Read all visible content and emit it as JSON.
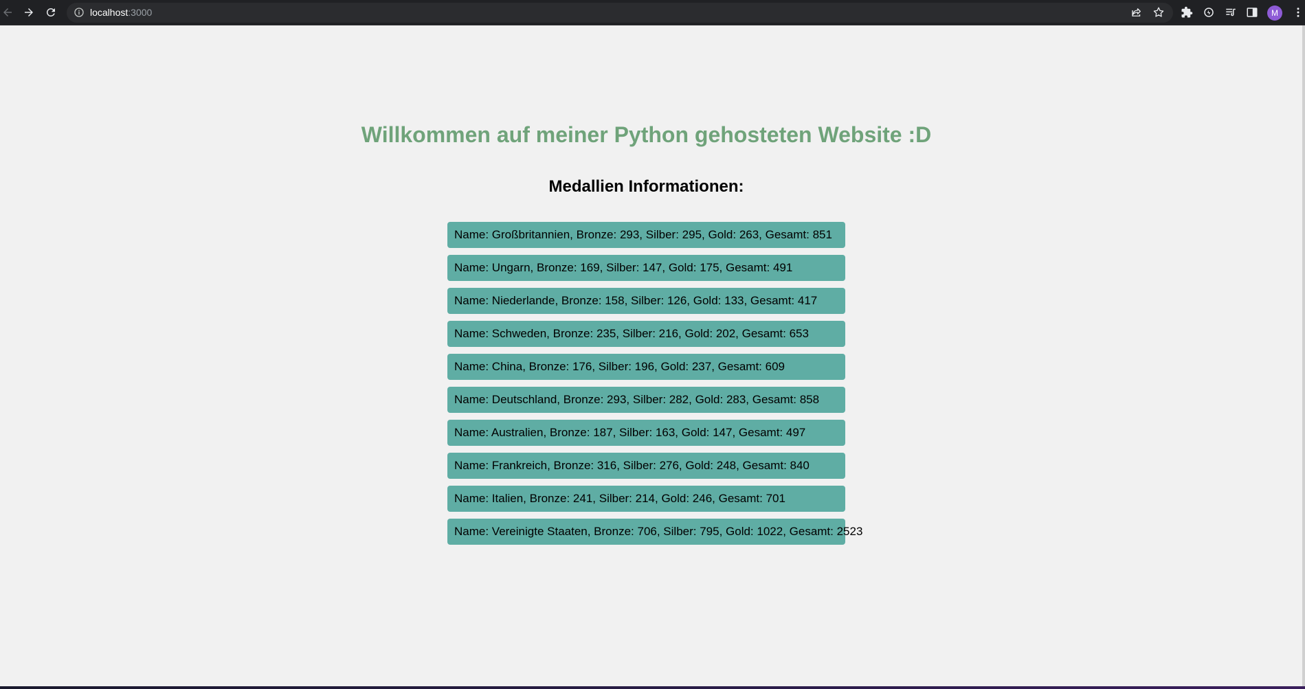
{
  "browser": {
    "url_host": "localhost",
    "url_port": ":3000",
    "profile_initial": "M"
  },
  "page": {
    "title": "Willkommen auf meiner Python gehosteten Website :D",
    "subtitle": "Medallien Informationen:",
    "medals": [
      "Name: Großbritannien, Bronze: 293, Silber: 295, Gold: 263, Gesamt: 851",
      "Name: Ungarn, Bronze: 169, Silber: 147, Gold: 175, Gesamt: 491",
      "Name: Niederlande, Bronze: 158, Silber: 126, Gold: 133, Gesamt: 417",
      "Name: Schweden, Bronze: 235, Silber: 216, Gold: 202, Gesamt: 653",
      "Name: China, Bronze: 176, Silber: 196, Gold: 237, Gesamt: 609",
      "Name: Deutschland, Bronze: 293, Silber: 282, Gold: 283, Gesamt: 858",
      "Name: Australien, Bronze: 187, Silber: 163, Gold: 147, Gesamt: 497",
      "Name: Frankreich, Bronze: 316, Silber: 276, Gold: 248, Gesamt: 840",
      "Name: Italien, Bronze: 241, Silber: 214, Gold: 246, Gesamt: 701",
      "Name: Vereinigte Staaten, Bronze: 706, Silber: 795, Gold: 1022, Gesamt: 2523"
    ]
  },
  "colors": {
    "title": "#6fa37a",
    "item_bg": "#5fada4",
    "page_bg": "#f1f1f1",
    "toolbar_bg": "#202124"
  },
  "icons": [
    "back-icon",
    "forward-icon",
    "reload-icon",
    "info-icon",
    "share-icon",
    "star-icon",
    "extensions-icon",
    "sync-icon",
    "reading-list-icon",
    "side-panel-icon",
    "menu-icon"
  ]
}
